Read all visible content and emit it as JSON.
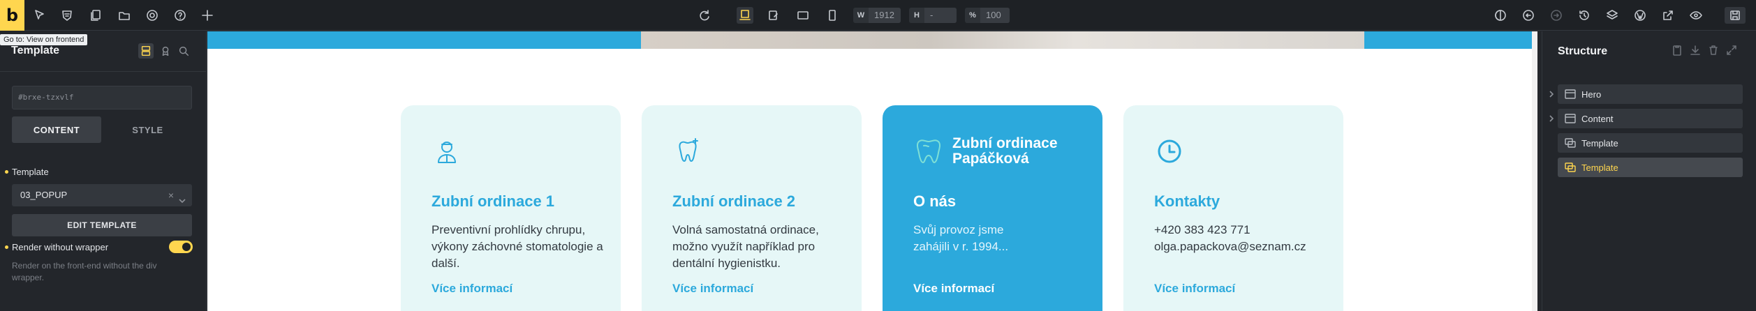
{
  "app": {
    "logo_letter": "b"
  },
  "toolbar": {
    "tooltip": "Go to: View on frontend",
    "width_key": "W",
    "width_value": "1912",
    "height_key": "H",
    "height_value": "-",
    "zoom_key": "%",
    "zoom_value": "100"
  },
  "left_panel": {
    "title": "Template",
    "element_id": "#brxe-tzxvlf",
    "tabs": [
      "CONTENT",
      "STYLE"
    ],
    "template_label": "Template",
    "template_value": "03_POPUP",
    "clear_glyph": "×",
    "edit_button": "EDIT TEMPLATE",
    "render_label": "Render without wrapper",
    "render_enabled": true,
    "render_help": "Render on the front-end without the div wrapper."
  },
  "canvas": {
    "colors": {
      "accent": "#2ca9dc",
      "card_bg": "#e6f7f7",
      "teal_icon": "#7fe0d6"
    },
    "cards": [
      {
        "icon": "doctor-icon",
        "title": "Zubní ordinace 1",
        "text": "Preventivní prohlídky chrupu, výkony záchovné stomatologie a další.",
        "link": "Více informací"
      },
      {
        "icon": "tooth-sparkle-icon",
        "title": "Zubní ordinace 2",
        "text": "Volná samostatná ordinace, možno využít například pro dentální hygienistku.",
        "link": "Více informací"
      },
      {
        "icon": "tooth-logo-icon",
        "brand": "Zubní ordinace Papáčková",
        "title": "O nás",
        "text": "Svůj provoz jsme zahájili v r. 1994...",
        "link": "Více informací"
      },
      {
        "icon": "clock-icon",
        "title": "Kontakty",
        "text": "+420 383 423 771 olga.papackova@seznam.cz",
        "link": "Více informací"
      }
    ]
  },
  "right_panel": {
    "title": "Structure",
    "items": [
      {
        "label": "Hero",
        "has_children": true
      },
      {
        "label": "Content",
        "has_children": true
      },
      {
        "label": "Template",
        "has_children": false
      },
      {
        "label": "Template",
        "has_children": false,
        "selected": true
      }
    ]
  }
}
